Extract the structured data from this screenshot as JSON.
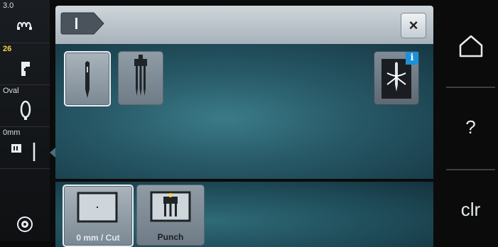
{
  "status": {
    "stitch_length": "3.0",
    "presser_foot": "26",
    "hoop": "Oval",
    "needle_position": "0mm"
  },
  "icons": {
    "stitch_icon": "stitch-pattern-icon",
    "foot_icon": "presser-foot-icon",
    "hoop_icon": "oval-hoop-icon",
    "needle_icon": "needle-position-icon",
    "settings_icon": "bobbin-icon",
    "close_icon": "close-icon",
    "home_icon": "home-icon",
    "info_icon": "info-icon"
  },
  "dialog": {
    "close_label": "×"
  },
  "needle_options": [
    "single-needle",
    "twin-needle"
  ],
  "cut_options": [
    {
      "label": "0 mm / Cut",
      "selected": true
    },
    {
      "label": "Punch",
      "selected": false
    }
  ],
  "right_panel": {
    "help_label": "?",
    "clear_label": "clr"
  },
  "colors": {
    "accent_blue": "#1e90d6",
    "status_yellow": "#ffd24a"
  }
}
